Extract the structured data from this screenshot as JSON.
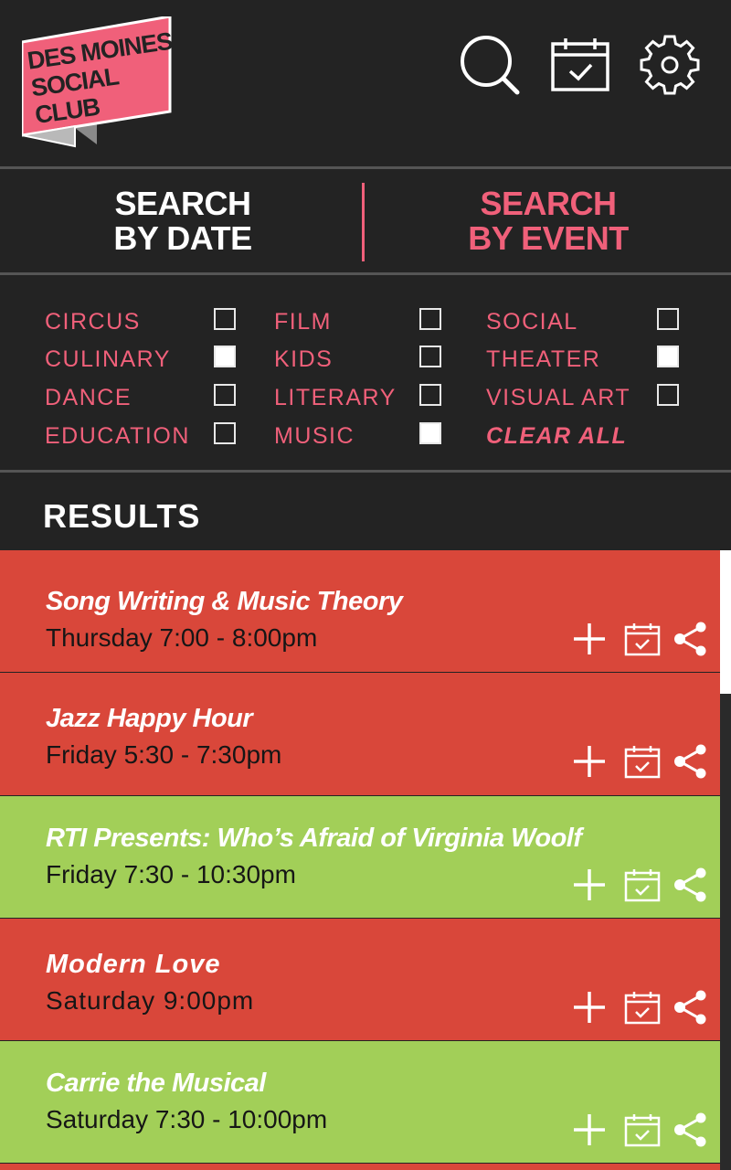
{
  "app": {
    "logo_text": "DES MOINES SOCIAL CLUB",
    "colors": {
      "background": "#232323",
      "accent": "#f0607a",
      "red_row": "#d9473a",
      "green_row": "#a2cf58",
      "logo_pink": "#f0607a"
    },
    "header_icons": [
      "search-icon",
      "calendar-icon",
      "gear-icon"
    ]
  },
  "tabs": {
    "date_label": "SEARCH\nBY DATE",
    "event_label": "SEARCH\nBY EVENT"
  },
  "filters": {
    "items": [
      {
        "label": "CIRCUS",
        "checked": false
      },
      {
        "label": "CULINARY",
        "checked": true
      },
      {
        "label": "DANCE",
        "checked": false
      },
      {
        "label": "EDUCATION",
        "checked": false
      },
      {
        "label": "FILM",
        "checked": false
      },
      {
        "label": "KIDS",
        "checked": false
      },
      {
        "label": "LITERARY",
        "checked": false
      },
      {
        "label": "MUSIC",
        "checked": true
      },
      {
        "label": "SOCIAL",
        "checked": false
      },
      {
        "label": "THEATER",
        "checked": true
      },
      {
        "label": "VISUAL ART",
        "checked": false
      }
    ],
    "clear_label": "CLEAR ALL"
  },
  "results": {
    "title": "RESULTS",
    "items": [
      {
        "title": "Song Writing & Music Theory",
        "time": "Thursday 7:00 - 8:00pm",
        "color": "#d9473a"
      },
      {
        "title": "Jazz Happy Hour",
        "time": "Friday 5:30 - 7:30pm",
        "color": "#d9473a"
      },
      {
        "title": "RTI Presents: Who’s Afraid of Virginia Woolf",
        "time": "Friday 7:30 - 10:30pm",
        "color": "#a2cf58"
      },
      {
        "title": "Modern Love",
        "time": "Saturday 9:00pm",
        "color": "#d9473a"
      },
      {
        "title": "Carrie the Musical",
        "time": "Saturday 7:30 - 10:00pm",
        "color": "#a2cf58"
      }
    ],
    "row_icons": [
      "plus-icon",
      "calendar-check-icon",
      "share-icon"
    ]
  }
}
